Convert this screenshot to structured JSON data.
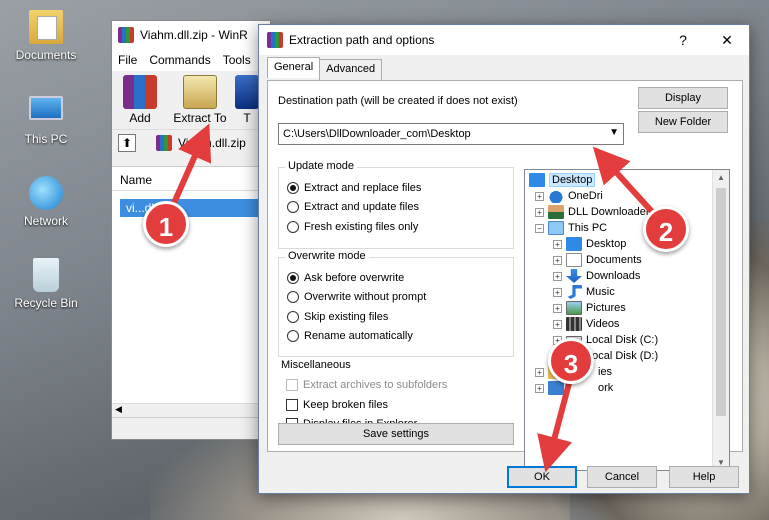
{
  "desktop": {
    "icons": [
      {
        "label": "Documents",
        "icon": "documents-folder-icon"
      },
      {
        "label": "This PC",
        "icon": "this-pc-icon"
      },
      {
        "label": "Network",
        "icon": "network-icon"
      },
      {
        "label": "Recycle Bin",
        "icon": "recycle-bin-icon"
      }
    ]
  },
  "winrar": {
    "title": "Viahm.dll.zip - WinR",
    "menu": [
      "File",
      "Commands",
      "Tools"
    ],
    "toolbar": {
      "add": "Add",
      "extract_to": "Extract To",
      "third": "T"
    },
    "path": "Viahm.dll.zip",
    "column_name": "Name",
    "file": "vi...dll"
  },
  "dialog": {
    "title": "Extraction path and options",
    "help": "?",
    "close": "✕",
    "tabs": [
      "General",
      "Advanced"
    ],
    "destination_label": "Destination path (will be created if does not exist)",
    "destination_value": "C:\\Users\\DllDownloader_com\\Desktop",
    "display_button": "Display",
    "new_folder_button": "New Folder",
    "update_mode": {
      "title": "Update mode",
      "options": [
        "Extract and replace files",
        "Extract and update files",
        "Fresh existing files only"
      ],
      "selected": 0
    },
    "overwrite_mode": {
      "title": "Overwrite mode",
      "options": [
        "Ask before overwrite",
        "Overwrite without prompt",
        "Skip existing files",
        "Rename automatically"
      ],
      "selected": 0
    },
    "misc": {
      "title": "Miscellaneous",
      "options": [
        "Extract archives to subfolders",
        "Keep broken files",
        "Display files in Explorer"
      ]
    },
    "save_settings": "Save settings",
    "tree": [
      "Desktop",
      "OneDri",
      "DLL Downloader.com",
      "This PC",
      "Desktop",
      "Documents",
      "Downloads",
      "Music",
      "Pictures",
      "Videos",
      "Local Disk (C:)",
      "Local Disk (D:)",
      "ies",
      "ork"
    ],
    "ok": "OK",
    "cancel": "Cancel",
    "help_button": "Help"
  },
  "callouts": [
    "1",
    "2",
    "3"
  ],
  "colors": {
    "callout": "#e23c3c",
    "selection": "#3d8ee0",
    "accent": "#0078d7"
  }
}
